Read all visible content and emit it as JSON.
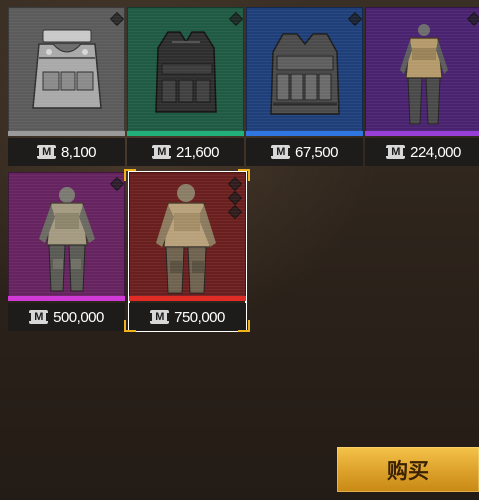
{
  "currency": {
    "symbol": "M",
    "icon": "m-coin-icon"
  },
  "items": [
    {
      "price": "8,100",
      "rarity": "common",
      "art_color": "#5a5a5a",
      "stripe_color": "#9a9a9a",
      "icon": "light-vest-icon"
    },
    {
      "price": "21,600",
      "rarity": "uncommon",
      "art_color": "#1f5a45",
      "stripe_color": "#22b07a",
      "icon": "tactical-vest-icon"
    },
    {
      "price": "67,500",
      "rarity": "rare",
      "art_color": "#1f3f7a",
      "stripe_color": "#2f76e0",
      "icon": "plate-carrier-icon"
    },
    {
      "price": "224,000",
      "rarity": "epic",
      "art_color": "#4a2370",
      "stripe_color": "#9a3ed8",
      "icon": "armor-suit-icon"
    },
    {
      "price": "500,000",
      "rarity": "legendary",
      "art_color": "#65235f",
      "stripe_color": "#d23ad8",
      "icon": "heavy-armor-suit-icon"
    },
    {
      "price": "750,000",
      "rarity": "mythic",
      "art_color": "#6a1f1f",
      "stripe_color": "#e02c24",
      "icon": "juggernaut-suit-icon",
      "selected": true
    }
  ],
  "buy_button": {
    "label": "购买"
  }
}
